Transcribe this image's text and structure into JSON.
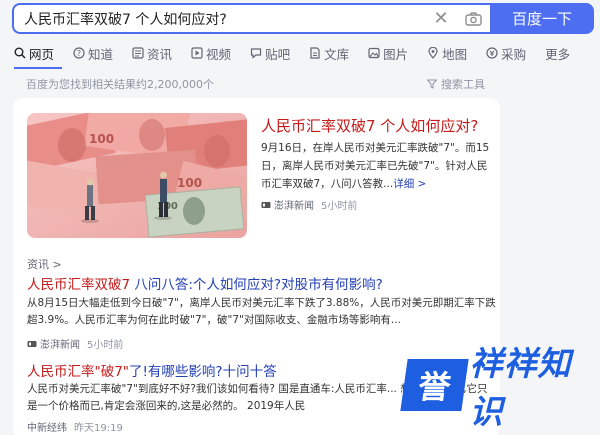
{
  "search": {
    "query": "人民币汇率双破7 个人如何应对?",
    "button_label": "百度一下"
  },
  "tabs": [
    {
      "label": "网页",
      "icon": "search-icon",
      "active": true
    },
    {
      "label": "知道",
      "icon": "question-icon"
    },
    {
      "label": "资讯",
      "icon": "news-icon"
    },
    {
      "label": "视频",
      "icon": "video-icon"
    },
    {
      "label": "贴吧",
      "icon": "forum-icon"
    },
    {
      "label": "文库",
      "icon": "document-icon"
    },
    {
      "label": "图片",
      "icon": "image-icon"
    },
    {
      "label": "地图",
      "icon": "map-icon"
    },
    {
      "label": "采购",
      "icon": "shop-icon"
    },
    {
      "label": "更多"
    }
  ],
  "result_stats": "百度为您找到相关结果约2,200,000个",
  "search_tools_label": "搜索工具",
  "top_result": {
    "title": "人民币汇率双破7 个人如何应对?",
    "snippet": "9月16日，在岸人民币对美元汇率跌破\"7\"。而15日，离岸人民币对美元汇率已先破\"7\"。针对人民币汇率双破7，八问八答教...",
    "more_label": "详细 >",
    "source": "澎湃新闻",
    "time": "5小时前"
  },
  "news_section_label": "资讯 >",
  "news_results": [
    {
      "title_highlight": "人民币汇率双破7",
      "title_rest": " 八问八答:个人如何应对?对股市有何影响?",
      "snippet": "从8月15日大幅走低到今日破\"7\"，离岸人民币对美元汇率下跌了3.88%，人民币对美元即期汇率下跌超3.9%。人民币汇率为何在此时破\"7\"，破\"7\"对国际收支、金融市场等影响有...",
      "source": "澎湃新闻",
      "time": "5小时前"
    },
    {
      "title_highlight": "人民币汇率\"破7\"",
      "title_rest": "了!有哪些影响?十问十答",
      "snippet": "人民币对美元汇率破\"7\"到底好不好?我们该如何看待? 国是直通车:人民币汇率... 想得那么严重,它只是一个价格而已,肯定会涨回来的,这是必然的。 2019年人民",
      "source": "中新经纬",
      "time": "昨天19:19"
    }
  ],
  "watermark": {
    "box_char": "誉",
    "text": "祥祥知识"
  },
  "colors": {
    "brand_blue": "#4e6ef2",
    "highlight_red": "#c61a1a",
    "link_blue": "#2440b3"
  }
}
